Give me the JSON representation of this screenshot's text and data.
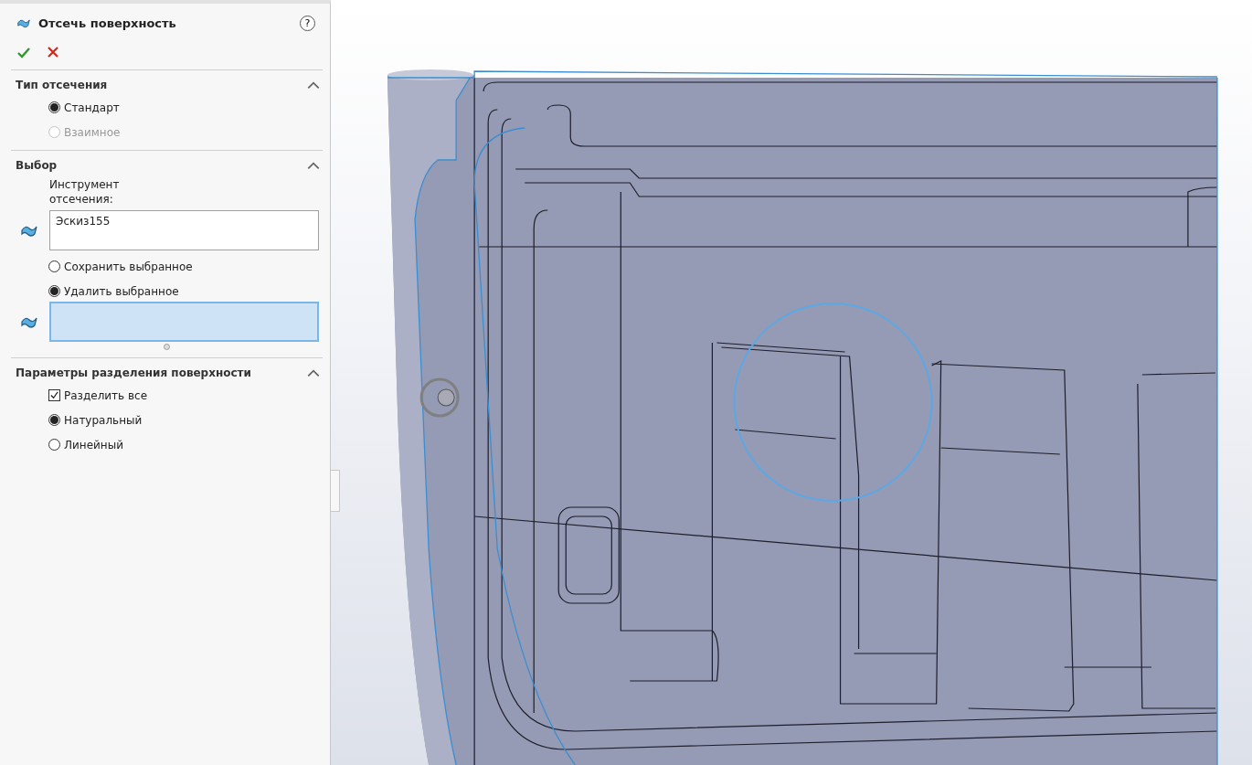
{
  "panel": {
    "title": "Отсечь поверхность",
    "help": "?",
    "sections": [
      {
        "title": "Тип отсечения",
        "expanded": true,
        "items": [
          {
            "kind": "radio",
            "label": "Стандарт",
            "selected": true,
            "disabled": false
          },
          {
            "kind": "radio",
            "label": "Взаимное",
            "selected": false,
            "disabled": true
          }
        ]
      },
      {
        "title": "Выбор",
        "expanded": true,
        "items": [
          {
            "kind": "field",
            "label": "Инструмент отсечения:",
            "value": "Эскиз155"
          },
          {
            "kind": "radio",
            "label": "Сохранить выбранное",
            "selected": false,
            "disabled": false
          },
          {
            "kind": "radio",
            "label": "Удалить выбранное",
            "selected": true,
            "disabled": false
          },
          {
            "kind": "selection",
            "active": true
          }
        ]
      },
      {
        "title": "Параметры разделения поверхности",
        "expanded": true,
        "items": [
          {
            "kind": "checkbox",
            "label": "Разделить все",
            "checked": true
          },
          {
            "kind": "radio",
            "label": "Натуральный",
            "selected": true,
            "disabled": false
          },
          {
            "kind": "radio",
            "label": "Линейный",
            "selected": false,
            "disabled": false
          }
        ]
      }
    ]
  }
}
